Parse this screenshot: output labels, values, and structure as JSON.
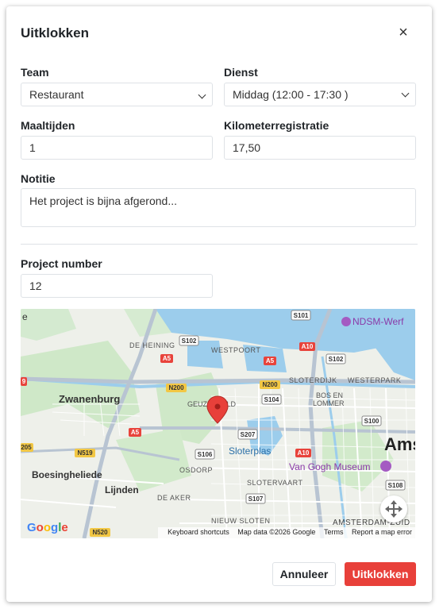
{
  "modal": {
    "title": "Uitklokken",
    "close_glyph": "×"
  },
  "form": {
    "team": {
      "label": "Team",
      "value": "Restaurant"
    },
    "dienst": {
      "label": "Dienst",
      "value": "Middag (12:00 - 17:30 )"
    },
    "maaltijden": {
      "label": "Maaltijden",
      "value": "1"
    },
    "kilometer": {
      "label": "Kilometerregistratie",
      "value": "17,50"
    },
    "notitie": {
      "label": "Notitie",
      "value": "Het project is bijna afgerond..."
    },
    "project_number": {
      "label": "Project number",
      "value": "12"
    }
  },
  "map": {
    "places": {
      "zwanenburg": "Zwanenburg",
      "boesingheliede": "Boesingheliede",
      "lijnden": "Lijnden",
      "de_heining": "DE HEINING",
      "westpoort": "WESTPOORT",
      "sloterdijk": "SLOTERDIJK",
      "westerpark": "WESTERPARK",
      "bos_en_lommer_1": "BOS EN",
      "bos_en_lommer_2": "LOMMER",
      "geuzenveld": "GEUZENVELD",
      "slotervaart": "SLOTERVAART",
      "osdorp": "OSDORP",
      "de_aker": "DE AKER",
      "nieuw_sloten": "NIEUW SLOTEN",
      "amsterdam_zuid": "AMSTERDAM-ZUID",
      "sloterplas": "Sloterplas",
      "van_gogh": "Van Gogh Museum",
      "ndsm": "NDSM-Werf",
      "ams": "Ams",
      "edge_e": "e"
    },
    "shields": {
      "s101": "S101",
      "s102a": "S102",
      "s102b": "S102",
      "a10a": "A10",
      "a10b": "A10",
      "a5a": "A5",
      "a5b": "A5",
      "a5c": "A5",
      "n200a": "N200",
      "n200b": "N200",
      "s104": "S104",
      "s207": "S207",
      "s106": "S106",
      "s100": "S100",
      "s108": "S108",
      "s107": "S107",
      "n519": "N519",
      "n520": "N520",
      "e205": "205",
      "e9": "9"
    },
    "google_logo": "Google",
    "attribution": {
      "shortcuts": "Keyboard shortcuts",
      "data": "Map data ©2026 Google",
      "terms": "Terms",
      "report": "Report a map error"
    },
    "colors": {
      "water": "#8fc8e8",
      "park": "#c8e6c0",
      "road": "#ffffff",
      "highway": "#b8c4d2",
      "marker": "#e8403a"
    }
  },
  "footer": {
    "cancel_label": "Annuleer",
    "submit_label": "Uitklokken"
  }
}
